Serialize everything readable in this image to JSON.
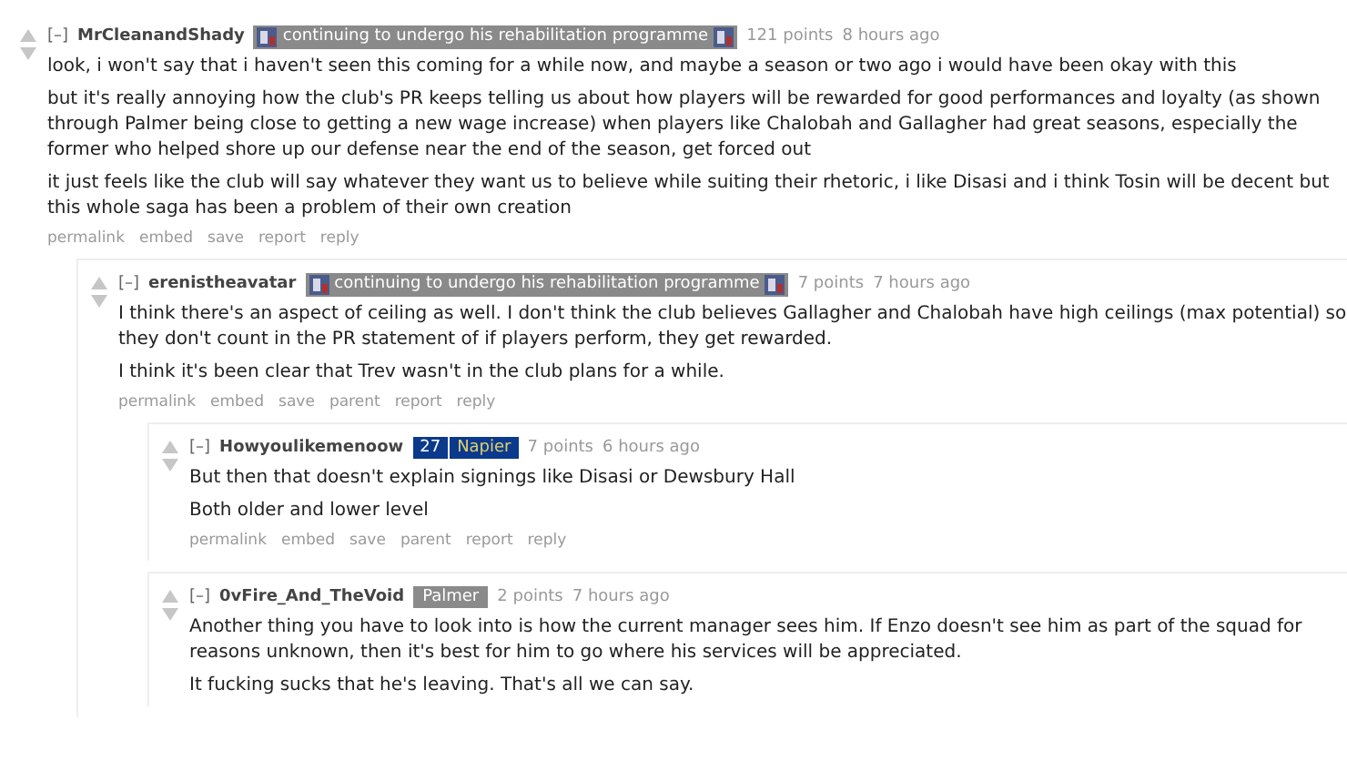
{
  "comments": [
    {
      "collapse": "[–]",
      "author": "MrCleanandShady",
      "flair": {
        "kind": "crest",
        "text": "continuing to undergo his rehabilitation programme"
      },
      "score": "121 points",
      "time": "8 hours ago",
      "paragraphs": [
        "look, i won't say that i haven't seen this coming for a while now, and maybe a season or two ago i would have been okay with this",
        "but it's really annoying how the club's PR keeps telling us about how players will be rewarded for good performances and loyalty (as shown through Palmer being close to getting a new wage increase) when players like Chalobah and Gallagher had great seasons, especially the former who helped shore up our defense near the end of the season, get forced out",
        "it just feels like the club will say whatever they want us to believe while suiting their rhetoric, i like Disasi and i think Tosin will be decent but this whole saga has been a problem of their own creation"
      ],
      "buttons": [
        "permalink",
        "embed",
        "save",
        "report",
        "reply"
      ],
      "children": [
        {
          "collapse": "[–]",
          "author": "erenistheavatar",
          "flair": {
            "kind": "crest",
            "text": "continuing to undergo his rehabilitation programme"
          },
          "score": "7 points",
          "time": "7 hours ago",
          "paragraphs": [
            "I think there's an aspect of ceiling as well. I don't think the club believes Gallagher and Chalobah have high ceilings (max potential) so they don't count in the PR statement of if players perform, they get rewarded.",
            "I think it's been clear that Trev wasn't in the club plans for a while."
          ],
          "buttons": [
            "permalink",
            "embed",
            "save",
            "parent",
            "report",
            "reply"
          ],
          "children": [
            {
              "collapse": "[–]",
              "author": "Howyoulikemenoow",
              "flair": {
                "kind": "number",
                "number": "27",
                "text": "Napier"
              },
              "score": "7 points",
              "time": "6 hours ago",
              "paragraphs": [
                "But then that doesn't explain signings like Disasi or Dewsbury Hall",
                "Both older and lower level"
              ],
              "buttons": [
                "permalink",
                "embed",
                "save",
                "parent",
                "report",
                "reply"
              ]
            },
            {
              "collapse": "[–]",
              "author": "0vFire_And_TheVoid",
              "flair": {
                "kind": "plain",
                "text": "Palmer"
              },
              "score": "2 points",
              "time": "7 hours ago",
              "paragraphs": [
                "Another thing you have to look into is how the current manager sees him. If Enzo doesn't see him as part of the squad for reasons unknown, then it's best for him to go where his services will be appreciated.",
                "It fucking sucks that he's leaving. That's all we can say."
              ]
            }
          ]
        }
      ]
    }
  ]
}
